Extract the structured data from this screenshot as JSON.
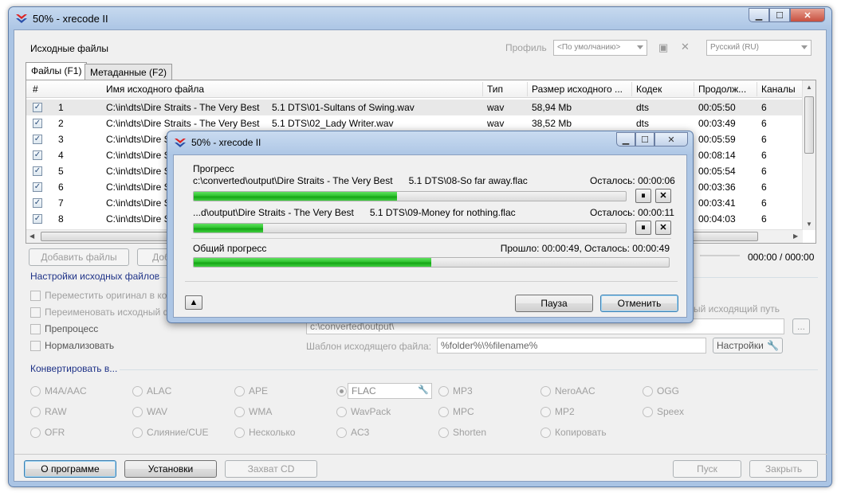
{
  "window": {
    "title": "50% - xrecode II"
  },
  "source": {
    "title": "Исходные файлы",
    "profile_label": "Профиль",
    "profile_value": "<По умолчанию>",
    "language_value": "Русский (RU)",
    "tabs": [
      "Файлы (F1)",
      "Метаданные (F2)"
    ],
    "columns": [
      "#",
      "Имя исходного файла",
      "Тип",
      "Размер исходного ...",
      "Кодек",
      "Продолж...",
      "Каналы"
    ],
    "rows": [
      {
        "n": "1",
        "path": "C:\\in\\dts\\Dire Straits - The Very Best",
        "name": "5.1 DTS\\01-Sultans of Swing.wav",
        "type": "wav",
        "size": "58,94 Mb",
        "codec": "dts",
        "dur": "00:05:50",
        "ch": "6"
      },
      {
        "n": "2",
        "path": "C:\\in\\dts\\Dire Straits - The Very Best",
        "name": "5.1 DTS\\02_Lady Writer.wav",
        "type": "wav",
        "size": "38,52 Mb",
        "codec": "dts",
        "dur": "00:03:49",
        "ch": "6"
      },
      {
        "n": "3",
        "path": "C:\\in\\dts\\Dire S",
        "name": "",
        "type": "",
        "size": "",
        "codec": "",
        "dur": "00:05:59",
        "ch": "6"
      },
      {
        "n": "4",
        "path": "C:\\in\\dts\\Dire S",
        "name": "",
        "type": "",
        "size": "",
        "codec": "",
        "dur": "00:08:14",
        "ch": "6"
      },
      {
        "n": "5",
        "path": "C:\\in\\dts\\Dire S",
        "name": "",
        "type": "",
        "size": "",
        "codec": "",
        "dur": "00:05:54",
        "ch": "6"
      },
      {
        "n": "6",
        "path": "C:\\in\\dts\\Dire S",
        "name": "",
        "type": "",
        "size": "",
        "codec": "",
        "dur": "00:03:36",
        "ch": "6"
      },
      {
        "n": "7",
        "path": "C:\\in\\dts\\Dire S",
        "name": "",
        "type": "",
        "size": "",
        "codec": "",
        "dur": "00:03:41",
        "ch": "6"
      },
      {
        "n": "8",
        "path": "C:\\in\\dts\\Dire S",
        "name": "",
        "type": "",
        "size": "",
        "codec": "",
        "dur": "00:04:03",
        "ch": "6"
      }
    ],
    "add_files": "Добавить файлы",
    "add_more": "Доб",
    "time_total": "000:00 / 000:00"
  },
  "settings": {
    "title": "Настройки исходных файлов",
    "options": [
      "Переместить оригинал в кор",
      "Переименовать исходный фа",
      "Препроцесс",
      "Нормализовать"
    ],
    "output_path_label": "ый исходящий путь",
    "output_path": "c:\\converted\\output\\",
    "browse": "...",
    "template_label": "Шаблон исходящего файла:",
    "template_value": "%folder%\\%filename%",
    "settings_button": "Настройки"
  },
  "convert": {
    "title": "Конвертировать в...",
    "formats": [
      [
        "M4A/AAC",
        "ALAC",
        "APE",
        "FLAC",
        "MP3",
        "NeroAAC",
        "OGG"
      ],
      [
        "RAW",
        "WAV",
        "WMA",
        "WavPack",
        "MPC",
        "MP2",
        "Speex"
      ],
      [
        "OFR",
        "Слияние/CUE",
        "Несколько",
        "AC3",
        "Shorten",
        "Копировать"
      ]
    ]
  },
  "bottom": {
    "about": "О программе",
    "setup": "Установки",
    "grab": "Захват CD",
    "start": "Пуск",
    "close": "Закрыть"
  },
  "dialog": {
    "title": "50% - xrecode II",
    "progress_label": "Прогресс",
    "item1": {
      "file": "c:\\converted\\output\\Dire Straits - The Very Best      5.1 DTS\\08-So far away.flac",
      "remaining": "Осталось: 00:00:06",
      "fraction": 0.47
    },
    "item2": {
      "file": "...d\\output\\Dire Straits - The Very Best      5.1 DTS\\09-Money for nothing.flac",
      "remaining": "Осталось: 00:00:11",
      "fraction": 0.16
    },
    "overall_label": "Общий прогресс",
    "overall_time": "Прошло: 00:00:49, Осталось: 00:00:49",
    "overall_fraction": 0.5,
    "pause": "Пауза",
    "cancel": "Отменить"
  }
}
